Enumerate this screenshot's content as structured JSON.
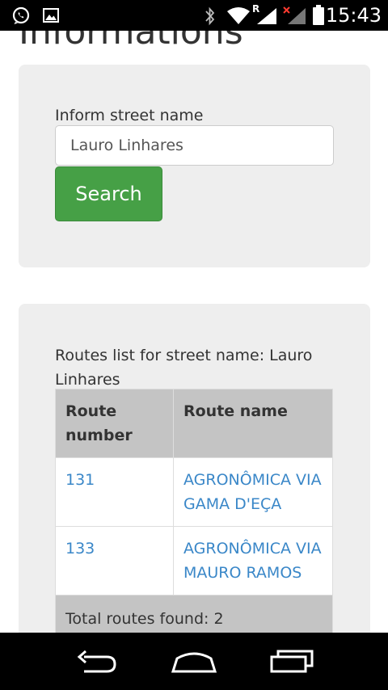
{
  "status_bar": {
    "time": "15:43",
    "roaming_indicator": "R",
    "left_icons": [
      "whatsapp-icon",
      "image-icon"
    ],
    "right_icons": [
      "bluetooth-icon",
      "wifi-icon",
      "signal-roaming-icon",
      "signal-no-service-icon",
      "battery-icon"
    ]
  },
  "page": {
    "title": "Informations"
  },
  "search_form": {
    "label": "Inform street name",
    "input_value": "Lauro Linhares",
    "button_label": "Search",
    "button_color": "#46a046"
  },
  "results": {
    "caption": "Routes list for street name: Lauro Linhares",
    "columns": [
      "Route number",
      "Route name"
    ],
    "rows": [
      {
        "number": "131",
        "name": "AGRONÔMICA VIA GAMA D'EÇA"
      },
      {
        "number": "133",
        "name": "AGRONÔMICA VIA MAURO RAMOS"
      }
    ],
    "total": "Total routes found: 2",
    "link_color": "#3a87c8"
  },
  "nav_bar": {
    "icons": [
      "back-icon",
      "home-icon",
      "recents-icon"
    ]
  }
}
